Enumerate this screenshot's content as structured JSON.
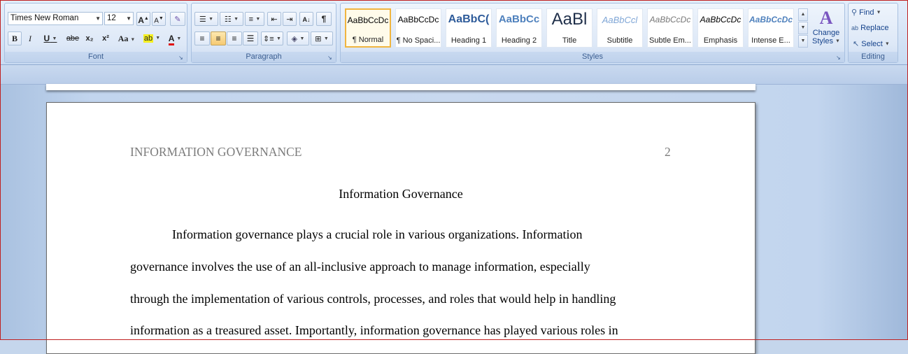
{
  "ribbon": {
    "font_group": {
      "label": "Font",
      "font_name": "Times New Roman",
      "font_size": "12",
      "grow_label": "A",
      "shrink_label": "A",
      "bold": "B",
      "italic": "I",
      "underline": "U",
      "strike": "abe",
      "subscript": "x₂",
      "superscript": "x²",
      "change_case": "Aa",
      "highlight": "ab",
      "font_color": "A"
    },
    "paragraph_group": {
      "label": "Paragraph",
      "pilcrow": "¶"
    },
    "styles_group": {
      "label": "Styles",
      "tiles": [
        {
          "sample": "AaBbCcDc",
          "name": "¶ Normal"
        },
        {
          "sample": "AaBbCcDc",
          "name": "¶ No Spaci..."
        },
        {
          "sample": "AaBbC(",
          "name": "Heading 1"
        },
        {
          "sample": "AaBbCc",
          "name": "Heading 2"
        },
        {
          "sample": "AaBl",
          "name": "Title"
        },
        {
          "sample": "AaBbCcl",
          "name": "Subtitle"
        },
        {
          "sample": "AaBbCcDc",
          "name": "Subtle Em..."
        },
        {
          "sample": "AaBbCcDc",
          "name": "Emphasis"
        },
        {
          "sample": "AaBbCcDc",
          "name": "Intense E..."
        }
      ],
      "change_styles_line1": "Change",
      "change_styles_line2": "Styles"
    },
    "editing_group": {
      "label": "Editing",
      "find": "Find",
      "replace": "Replace",
      "select": "Select"
    }
  },
  "document": {
    "header_text": "INFORMATION GOVERNANCE",
    "page_number": "2",
    "title": "Information Governance",
    "body_lines": [
      "Information governance plays a crucial role in various organizations. Information",
      "governance involves the use of an all-inclusive approach to manage information, especially",
      "through the implementation of various controls, processes, and roles that would help in handling",
      "information as a treasured asset. Importantly, information governance has played various roles in"
    ]
  },
  "colors": {
    "accent_border": "#c02020",
    "selected_style_border": "#f0b540",
    "group_label_text": "#3b5e91"
  }
}
